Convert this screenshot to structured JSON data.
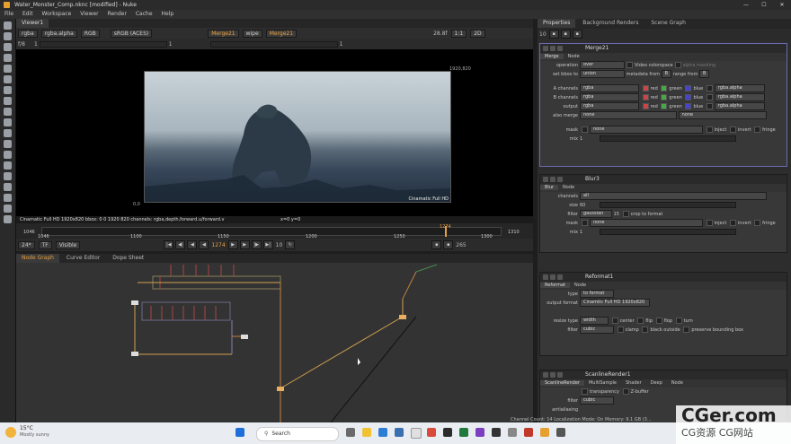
{
  "titlebar": {
    "title": "Water_Monster_Comp.nknc [modified] - Nuke",
    "min": "—",
    "max": "☐",
    "close": "✕"
  },
  "menu": [
    "File",
    "Edit",
    "Workspace",
    "Viewer",
    "Render",
    "Cache",
    "Help"
  ],
  "viewer": {
    "tab": "Viewer1",
    "ctrl1": {
      "layer": "rgba",
      "channel": "rgba.alpha",
      "rgb": "RGB",
      "colorspace": "sRGB (ACES)",
      "inputA": "Merge21",
      "wipe": "wipe",
      "inputB": "Merge21",
      "zoom": "28.8f",
      "ratio": "1:1",
      "mode": "2D"
    },
    "ctrl2": {
      "fstop": "f/8",
      "gain": "1",
      "frame": "1",
      "gamma": "1"
    },
    "format_top": "1920,820",
    "format_label": "Cinamatic Full HD",
    "origin": "0,0",
    "info": "Cinamatic Full HD 1920x820   bbox: 0 0 1920 820 channels: rgba,depth,forward.u/forward.v",
    "coords": "x=0 y=0",
    "timeline": {
      "start": "1046",
      "end": "1310",
      "current": "1274",
      "ticks": [
        "1046",
        "1100",
        "1150",
        "1200",
        "1250",
        "1300",
        "1310"
      ]
    },
    "playback": {
      "fps": "24*",
      "tf": "TF",
      "visible": "Visible",
      "frame": "1274",
      "step": "10",
      "end": "265"
    }
  },
  "nodegraph": {
    "tabs": [
      "Node Graph",
      "Curve Editor",
      "Dope Sheet"
    ]
  },
  "properties": {
    "tabs": [
      "Properties",
      "Background Renders",
      "Scene Graph"
    ],
    "max_panels": "10",
    "merge": {
      "name": "Merge21",
      "tabs": [
        "Merge",
        "Node"
      ],
      "operation_k": "operation",
      "operation": "over",
      "video_cs": "Video colorspace",
      "alpha_mask": "alpha masking",
      "bbox_k": "set bbox to",
      "bbox": "union",
      "metadata_k": "metadata from",
      "metadata": "B",
      "range_k": "range from",
      "range": "B",
      "a_k": "A channels",
      "b_k": "B channels",
      "out_k": "output",
      "rgba": "rgba",
      "red": "red",
      "green": "green",
      "blue": "blue",
      "alpha": "rgba.alpha",
      "also_k": "also merge",
      "also": "none",
      "also2": "none",
      "mask_k": "mask",
      "mask": "none",
      "inject": "inject",
      "invert": "invert",
      "fringe": "fringe",
      "mix_k": "mix",
      "mix": "1"
    },
    "blur": {
      "name": "Blur3",
      "tabs": [
        "Blur",
        "Node"
      ],
      "channels_k": "channels",
      "channels": "all",
      "size_k": "size",
      "size": "60",
      "filter_k": "filter",
      "filter": "gaussian",
      "quality": "15",
      "crop": "crop to format",
      "mask_k": "mask",
      "mask": "none",
      "inject": "inject",
      "invert": "invert",
      "fringe": "fringe",
      "mix_k": "mix",
      "mix": "1"
    },
    "reformat": {
      "name": "Reformat1",
      "tabs": [
        "Reformat",
        "Node"
      ],
      "type_k": "type",
      "type": "to format",
      "outfmt_k": "output format",
      "outfmt": "Cinamtic Full HD 1920x820",
      "resize_k": "resize type",
      "resize": "width",
      "center": "center",
      "flip": "flip",
      "flop": "flop",
      "turn": "turn",
      "filter_k": "filter",
      "filter": "cubic",
      "clamp": "clamp",
      "black": "black outside",
      "preserve": "preserve bounding box"
    },
    "scanline": {
      "name": "ScanlineRender1",
      "tabs": [
        "ScanlineRender",
        "MultiSample",
        "Shader",
        "Deep",
        "Node"
      ],
      "transparency": "transparency",
      "zbuffer": "Z-buffer",
      "filter_k": "filter",
      "filter": "cubic",
      "antialias_k": "antialiasing"
    }
  },
  "statusbar": {
    "text": "Channel Count: 14  Localization Mode: On  Memory: 9.1 GB (3..."
  },
  "taskbar": {
    "weather_temp": "15°C",
    "weather_desc": "Mostly sunny",
    "search": "Search"
  },
  "watermark": {
    "line1": "CGer.com",
    "line2": "CG资源 CG网站"
  }
}
